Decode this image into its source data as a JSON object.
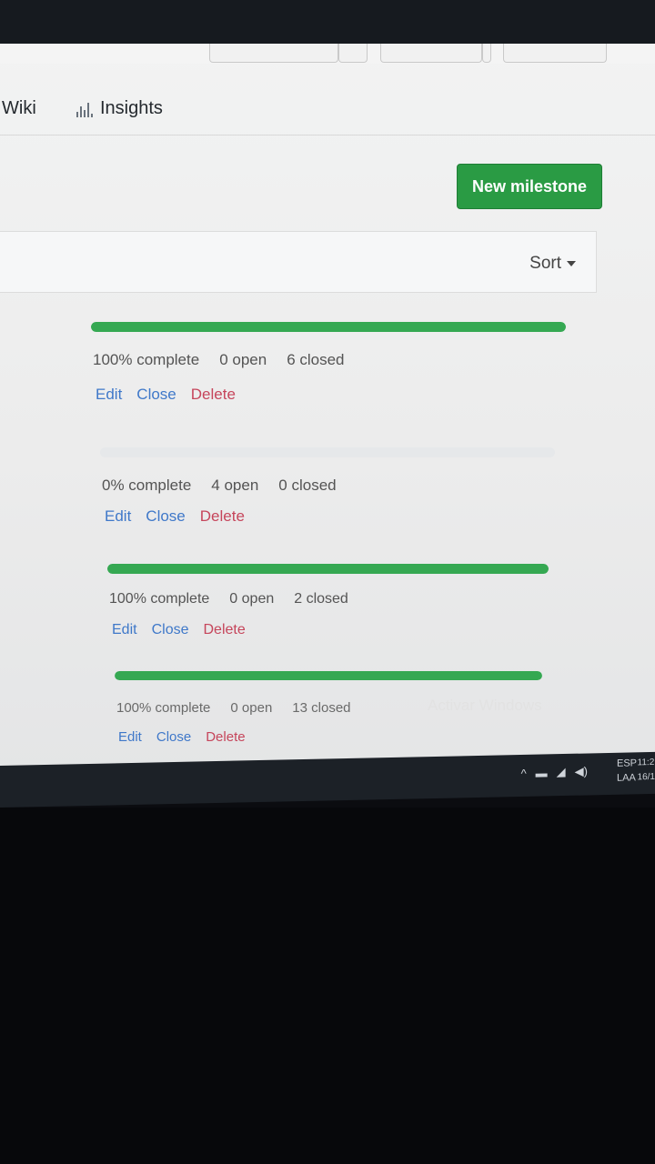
{
  "nav": {
    "wiki": "Wiki",
    "insights": "Insights",
    "insights_icon": "graph-icon"
  },
  "header": {
    "new_milestone": "New milestone"
  },
  "sort": {
    "label": "Sort"
  },
  "milestones": [
    {
      "percent_label": "100% complete",
      "progress": 1.0,
      "open": "0 open",
      "closed": "6 closed"
    },
    {
      "percent_label": "0% complete",
      "progress": 0.0,
      "open": "4 open",
      "closed": "0 closed"
    },
    {
      "percent_label": "100% complete",
      "progress": 1.0,
      "open": "0 open",
      "closed": "2 closed"
    },
    {
      "percent_label": "100% complete",
      "progress": 1.0,
      "open": "0 open",
      "closed": "13 closed"
    }
  ],
  "actions": {
    "edit": "Edit",
    "close": "Close",
    "delete": "Delete"
  },
  "watermark": "Activar Windows",
  "taskbar": {
    "lang_top": "ESP",
    "lang_bottom": "LAA",
    "time": "11:2",
    "date": "16/1"
  },
  "colors": {
    "primary_green": "#2a9b44",
    "progress_green": "#35a852",
    "link_blue": "#3f78c9",
    "delete_red": "#c6455b"
  }
}
